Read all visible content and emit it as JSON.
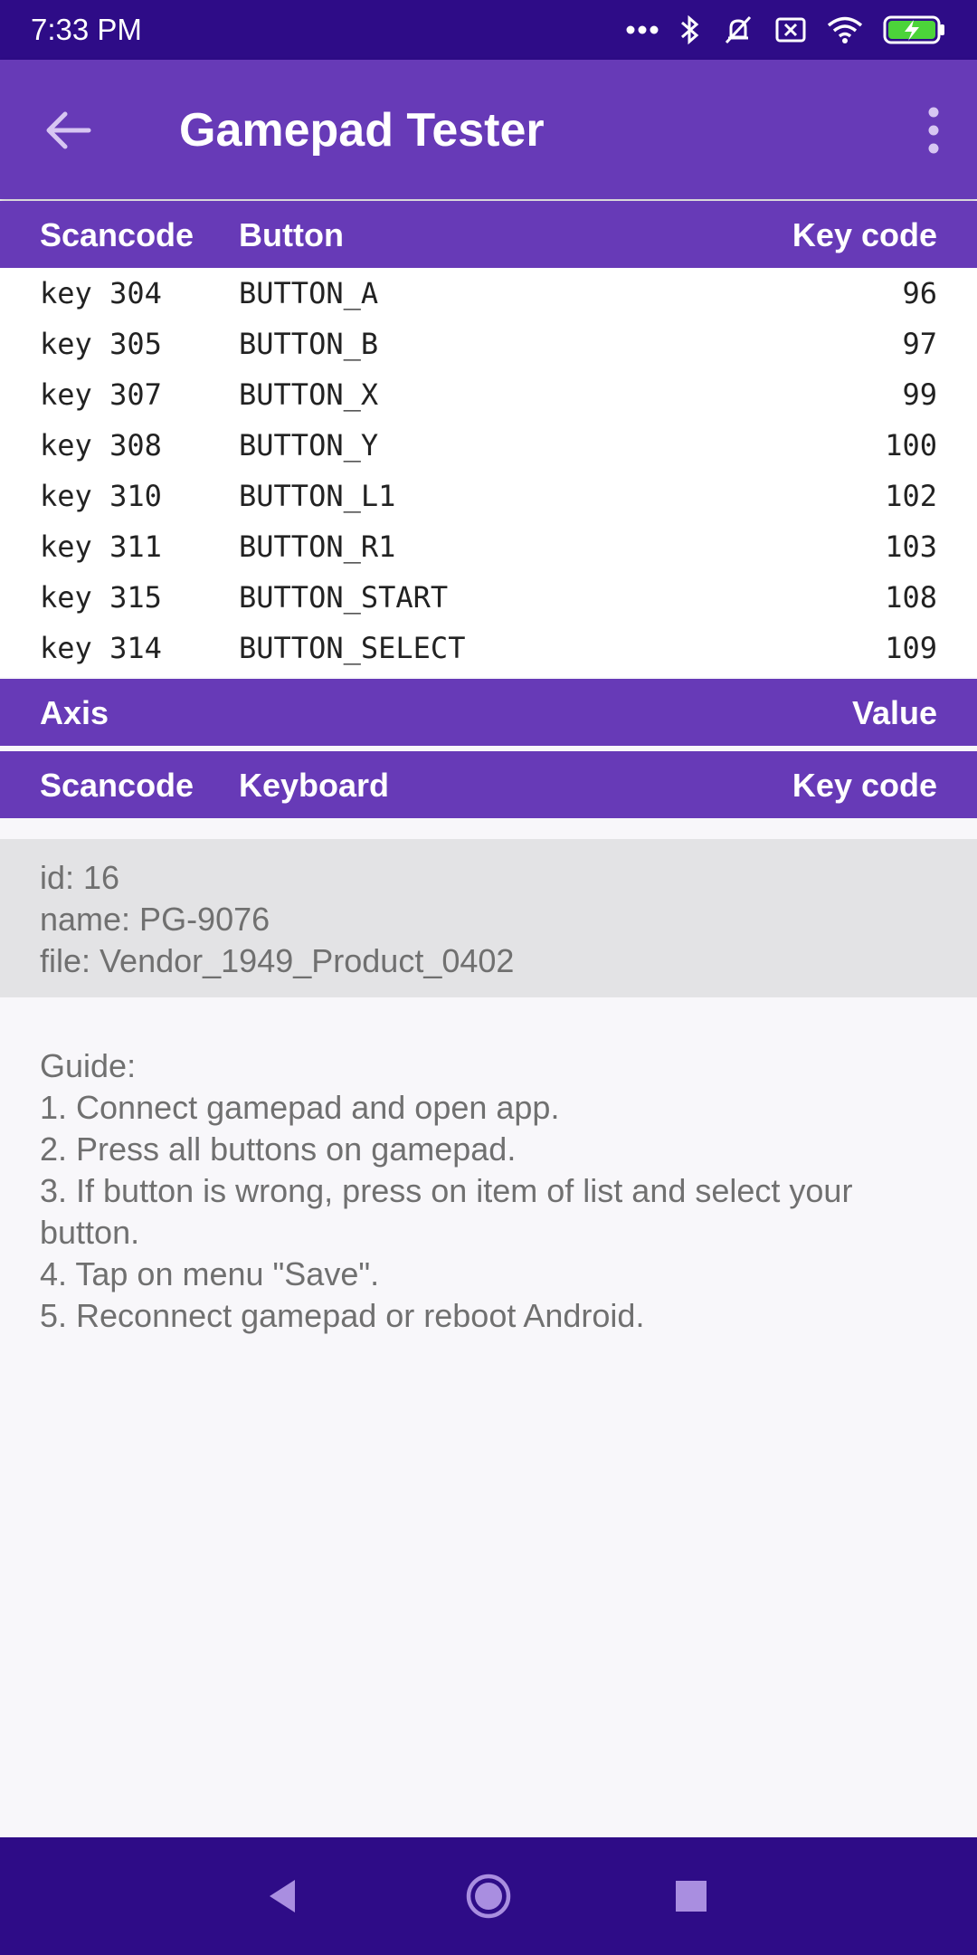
{
  "status_bar": {
    "time": "7:33 PM",
    "icons": [
      "more-dots-icon",
      "bluetooth-icon",
      "mute-icon",
      "sim-card-icon",
      "wifi-icon",
      "battery-charging-icon"
    ]
  },
  "app_bar": {
    "title": "Gamepad Tester",
    "back_icon": "arrow-back-icon",
    "menu_icon": "more-vert-icon"
  },
  "buttons_table": {
    "headers": [
      "Scancode",
      "Button",
      "Key code"
    ],
    "rows": [
      {
        "scancode": "key 304",
        "button": "BUTTON_A",
        "keycode": "96"
      },
      {
        "scancode": "key 305",
        "button": "BUTTON_B",
        "keycode": "97"
      },
      {
        "scancode": "key 307",
        "button": "BUTTON_X",
        "keycode": "99"
      },
      {
        "scancode": "key 308",
        "button": "BUTTON_Y",
        "keycode": "100"
      },
      {
        "scancode": "key 310",
        "button": "BUTTON_L1",
        "keycode": "102"
      },
      {
        "scancode": "key 311",
        "button": "BUTTON_R1",
        "keycode": "103"
      },
      {
        "scancode": "key 315",
        "button": "BUTTON_START",
        "keycode": "108"
      },
      {
        "scancode": "key 314",
        "button": "BUTTON_SELECT",
        "keycode": "109"
      }
    ]
  },
  "axis_table": {
    "headers": [
      "Axis",
      "Value"
    ]
  },
  "keyboard_table": {
    "headers": [
      "Scancode",
      "Keyboard",
      "Key code"
    ]
  },
  "device": {
    "id": "id: 16",
    "name": "name: PG-9076",
    "file": "file: Vendor_1949_Product_0402"
  },
  "guide": {
    "title": "Guide:",
    "steps": [
      "1. Connect gamepad and open app.",
      "2. Press all buttons on gamepad.",
      "3. If button is wrong, press on item of list and select your button.",
      "4. Tap on menu \"Save\".",
      "5. Reconnect gamepad or reboot Android."
    ]
  },
  "nav_bar": {
    "icons": [
      "nav-back-icon",
      "nav-home-icon",
      "nav-recents-icon"
    ]
  },
  "colors": {
    "primary": "#673ab7",
    "primary_dark": "#2e0c87",
    "text_secondary": "#707070"
  }
}
